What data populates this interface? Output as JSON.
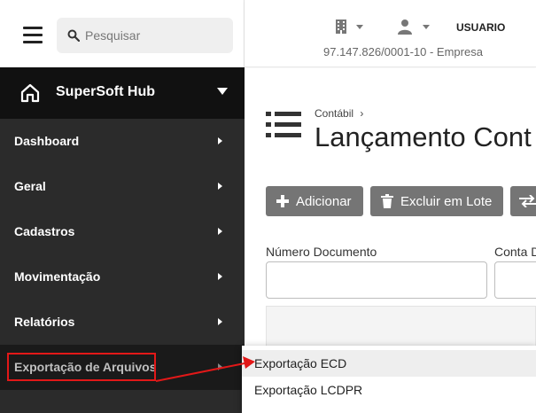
{
  "sidebar": {
    "search_placeholder": "Pesquisar",
    "brand": "SuperSoft Hub",
    "items": [
      {
        "label": "Dashboard"
      },
      {
        "label": "Geral"
      },
      {
        "label": "Cadastros"
      },
      {
        "label": "Movimentação"
      },
      {
        "label": "Relatórios"
      },
      {
        "label": "Exportação de Arquivos"
      }
    ]
  },
  "header": {
    "user": "USUARIO",
    "company": "97.147.826/0001-10 - Empresa"
  },
  "main": {
    "breadcrumb": "Contábil",
    "breadcrumb_sep": "›",
    "title": "Lançamento Cont",
    "buttons": {
      "add": "Adicionar",
      "delete_batch": "Excluir em Lote"
    },
    "fields": {
      "document_number": "Número Documento",
      "account": "Conta D"
    }
  },
  "submenu": {
    "items": [
      {
        "label": "Exportação ECD"
      },
      {
        "label": "Exportação LCDPR"
      }
    ]
  },
  "colors": {
    "sidebar_bg": "#2b2b2b",
    "brand_bg": "#111111",
    "button_bg": "#757575",
    "annotation_red": "#e21818"
  }
}
